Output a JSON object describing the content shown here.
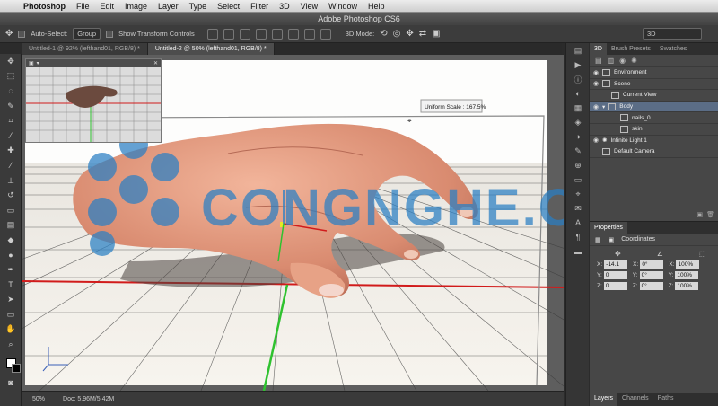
{
  "menubar": {
    "app": "Photoshop",
    "items": [
      "File",
      "Edit",
      "Image",
      "Layer",
      "Type",
      "Select",
      "Filter",
      "3D",
      "View",
      "Window",
      "Help"
    ]
  },
  "title": "Adobe Photoshop CS6",
  "options": {
    "auto_select": "Auto-Select:",
    "group": "Group",
    "transform": "Show Transform Controls",
    "mode_label": "3D Mode:",
    "workspace": "3D"
  },
  "tabs": [
    "Untitled-1 @ 92% (lefthand01, RGB/8) *",
    "Untitled-2 @ 50% (lefthand01, RGB/8) *"
  ],
  "canvas": {
    "tooltip": "Uniform Scale : 167.5%",
    "watermark": "CONGNGHE.ORG"
  },
  "status": {
    "zoom": "50%",
    "doc": "Doc: 5.96M/5.42M"
  },
  "panel": {
    "tabs": [
      "3D",
      "Brush Presets",
      "Swatches"
    ],
    "layers": [
      {
        "name": "Environment",
        "indent": 0
      },
      {
        "name": "Scene",
        "indent": 0
      },
      {
        "name": "Current View",
        "indent": 1
      },
      {
        "name": "Body",
        "indent": 1
      },
      {
        "name": "nails_0",
        "indent": 2
      },
      {
        "name": "skin",
        "indent": 2
      },
      {
        "name": "Infinite Light 1",
        "indent": 1
      },
      {
        "name": "Default Camera",
        "indent": 1
      }
    ],
    "properties_tab": "Properties",
    "coordinates": "Coordinates",
    "coords": {
      "x": {
        "label": "X:",
        "value": "-14.1",
        "rot": "0°",
        "scale": "100%"
      },
      "y": {
        "label": "Y:",
        "value": "0",
        "rot": "0°",
        "scale": "100%"
      },
      "z": {
        "label": "Z:",
        "value": "0",
        "rot": "0°",
        "scale": "100%"
      }
    },
    "bottom_tabs": [
      "Layers",
      "Channels",
      "Paths"
    ]
  },
  "colors": {
    "accent": "#5b6d86",
    "skin": "#e7a286",
    "redline": "#d11b1b",
    "greenline": "#2fc22f",
    "watermark": "#2a7fc4"
  }
}
